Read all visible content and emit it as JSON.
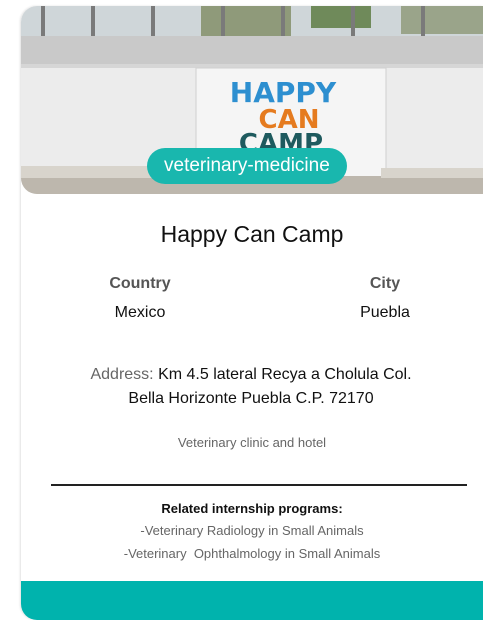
{
  "card": {
    "category_tag": "veterinary-medicine",
    "title": "Happy Can Camp",
    "country_label": "Country",
    "country_value": "Mexico",
    "city_label": "City",
    "city_value": "Puebla",
    "address_label": "Address:",
    "address_line1": "Km 4.5 lateral Recya a Cholula Col.",
    "address_line2": "Bella Horizonte Puebla C.P. 72170",
    "description": "Veterinary clinic and hotel",
    "related_title": "Related internship programs:",
    "programs": [
      "-Veterinary Radiology in Small Animals",
      "-Veterinary  Ophthalmology in Small Animals"
    ]
  },
  "photo_sign": {
    "line1": "HAPPY",
    "line2": "CAN",
    "line3": "CAMP"
  },
  "colors": {
    "accent": "#19b7ae",
    "footer": "#00b3ad",
    "sign_blue": "#2d8fd0",
    "sign_orange": "#e57b1f",
    "sign_dark": "#1e5a5e"
  }
}
